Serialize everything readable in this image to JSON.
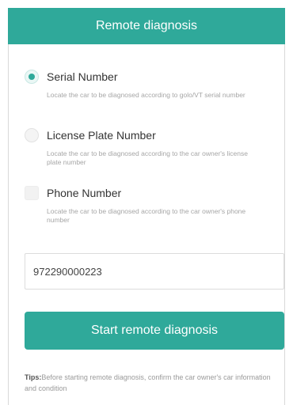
{
  "header": {
    "title": "Remote diagnosis"
  },
  "options": [
    {
      "label": "Serial Number",
      "description": "Locate the car to be diagnosed according to golo/VT serial number",
      "selected": true
    },
    {
      "label": "License Plate Number",
      "description": "Locate the car to be diagnosed according to the car owner's license plate number",
      "selected": false
    },
    {
      "label": "Phone Number",
      "description": "Locate the car to be diagnosed according to the car owner's phone number",
      "selected": false
    }
  ],
  "input": {
    "value": "972290000223"
  },
  "action": {
    "start_label": "Start remote diagnosis"
  },
  "tips": {
    "prefix": "Tips:",
    "text": "Before starting remote diagnosis, confirm the car owner's car information and condition"
  },
  "colors": {
    "accent": "#2fa99a"
  }
}
